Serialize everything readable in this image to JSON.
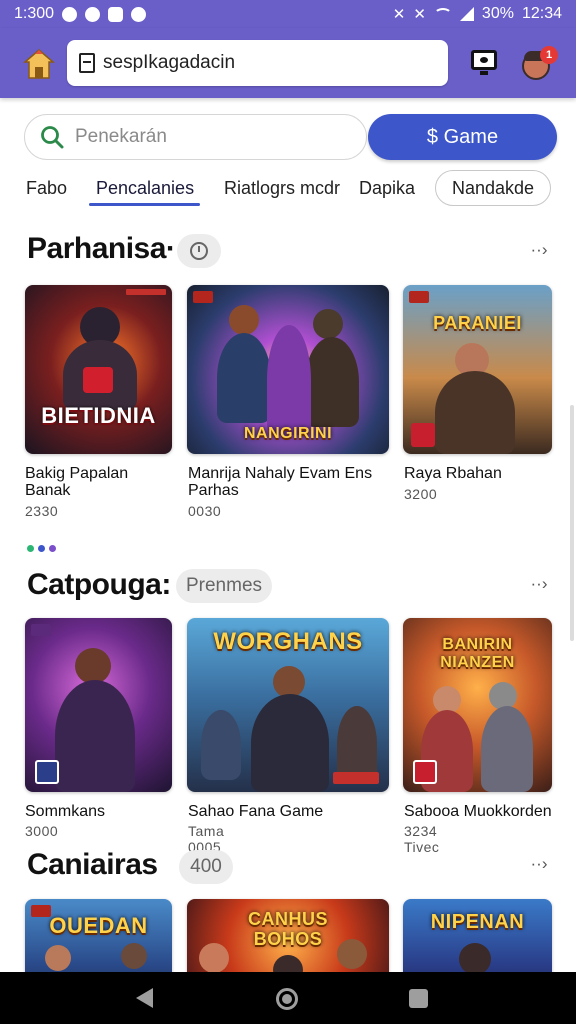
{
  "status_bar": {
    "time_left": "1:300",
    "battery": "30%",
    "time_right": "12:34"
  },
  "url_bar": {
    "text": "sespIkagadacin"
  },
  "avatar_badge": "1",
  "search": {
    "placeholder": "Penekarán",
    "value": ""
  },
  "game_button": {
    "label": "$ Game"
  },
  "tabs": [
    {
      "label": "Fabo"
    },
    {
      "label": "Pencalanies"
    },
    {
      "label": "Riatlogrs mcdr"
    },
    {
      "label": "Dapika"
    },
    {
      "label": "Nandakde"
    }
  ],
  "sections": [
    {
      "title": "Parhanisa·",
      "chip": "",
      "items": [
        {
          "title": "Bakig Papalan Banak",
          "meta": "2330",
          "banner": "BIETIDNIA"
        },
        {
          "title": "Manrija Nahaly Evam Ens Parhas",
          "meta": "0030",
          "banner": "NANGIRINI"
        },
        {
          "title": "Raya Rbahan",
          "meta": "3200",
          "banner": "PARANIEI"
        }
      ]
    },
    {
      "title": "Catpouga:",
      "chip": "Prenmes",
      "items": [
        {
          "title": "Sommkans",
          "meta": "3000",
          "banner": ""
        },
        {
          "title": "Sahao Fana Game",
          "meta": "Tama 0005",
          "banner": "WORGHANS"
        },
        {
          "title": "Sabooa Muokkorden",
          "meta": "3234 Tivec",
          "banner": "BANIRIN NIANZEN"
        }
      ]
    },
    {
      "title": "Caniairas",
      "chip": "400",
      "items": [
        {
          "title": "",
          "meta": "",
          "banner": "OUEDAN"
        },
        {
          "title": "",
          "meta": "",
          "banner": "CANHUS BOHOS"
        },
        {
          "title": "",
          "meta": "",
          "banner": "NIPENAN"
        }
      ]
    }
  ],
  "colors": {
    "app_bar": "#6a5fc9",
    "accent": "#3d56c9",
    "pager_dots": [
      "#2bb673",
      "#3d56c9",
      "#7a4fc9"
    ]
  },
  "icons": [
    "home-castle-icon",
    "document-icon",
    "tv-icon",
    "avatar-icon",
    "search-icon",
    "clock-icon",
    "arrow-right-icon",
    "back-icon",
    "home-icon",
    "recents-icon"
  ]
}
